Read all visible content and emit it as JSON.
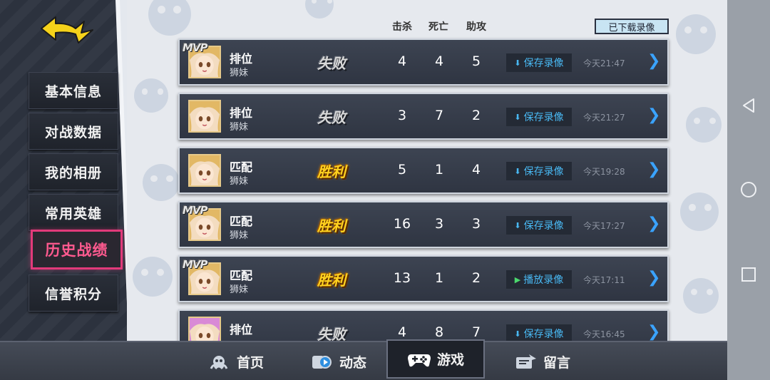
{
  "sidebar": {
    "items": [
      {
        "label": "基本信息",
        "active": false
      },
      {
        "label": "对战数据",
        "active": false
      },
      {
        "label": "我的相册",
        "active": false
      },
      {
        "label": "常用英雄",
        "active": false
      },
      {
        "label": "历史战绩",
        "active": true
      },
      {
        "label": "信誉积分",
        "active": false
      }
    ]
  },
  "header": {
    "columns": {
      "kills": "击杀",
      "deaths": "死亡",
      "assists": "助攻"
    },
    "downloaded_button": "已下载录像"
  },
  "records": [
    {
      "mvp": "MVP",
      "mode": "排位",
      "hero": "狮妹",
      "result": "失败",
      "result_type": "lose",
      "kills": "4",
      "deaths": "4",
      "assists": "5",
      "action": "保存录像",
      "action_type": "save",
      "time": "今天21:47"
    },
    {
      "mvp": "",
      "mode": "排位",
      "hero": "狮妹",
      "result": "失败",
      "result_type": "lose",
      "kills": "3",
      "deaths": "7",
      "assists": "2",
      "action": "保存录像",
      "action_type": "save",
      "time": "今天21:27"
    },
    {
      "mvp": "",
      "mode": "匹配",
      "hero": "狮妹",
      "result": "胜利",
      "result_type": "win",
      "kills": "5",
      "deaths": "1",
      "assists": "4",
      "action": "保存录像",
      "action_type": "save",
      "time": "今天19:28"
    },
    {
      "mvp": "MVP",
      "mode": "匹配",
      "hero": "狮妹",
      "result": "胜利",
      "result_type": "win",
      "kills": "16",
      "deaths": "3",
      "assists": "3",
      "action": "保存录像",
      "action_type": "save",
      "time": "今天17:27"
    },
    {
      "mvp": "MVP",
      "mode": "匹配",
      "hero": "狮妹",
      "result": "胜利",
      "result_type": "win",
      "kills": "13",
      "deaths": "1",
      "assists": "2",
      "action": "播放录像",
      "action_type": "play",
      "time": "今天17:11"
    },
    {
      "mvp": "",
      "mode": "排位",
      "hero": "",
      "result": "失败",
      "result_type": "lose",
      "kills": "4",
      "deaths": "8",
      "assists": "7",
      "action": "保存录像",
      "action_type": "save",
      "time": "今天16:45"
    }
  ],
  "bottom_tabs": [
    {
      "label": "首页",
      "icon": "home-creature-icon",
      "active": false
    },
    {
      "label": "动态",
      "icon": "moments-icon",
      "active": false
    },
    {
      "label": "游戏",
      "icon": "gamepad-icon",
      "active": true
    },
    {
      "label": "留言",
      "icon": "message-icon",
      "active": false
    }
  ],
  "colors": {
    "accent_pink": "#e23a7a",
    "link_blue": "#49b8f2",
    "win_gold": "#ffd21f",
    "back_yellow": "#f5d21a"
  }
}
